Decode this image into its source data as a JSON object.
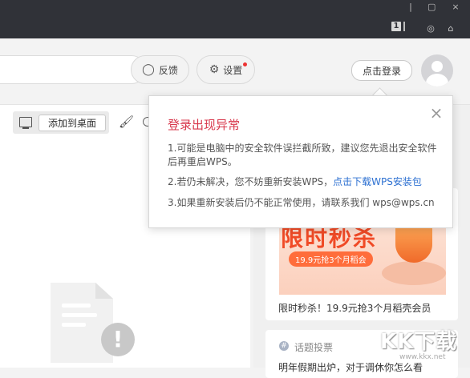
{
  "titlebar": {
    "tab_count": "1"
  },
  "header": {
    "feedback_label": "反馈",
    "settings_label": "设置",
    "login_label": "点击登录"
  },
  "toolbar": {
    "add_to_desktop_label": "添加到桌面"
  },
  "popup": {
    "title": "登录出现异常",
    "close_icon": "×",
    "line1": "1.可能是电脑中的安全软件误拦截所致，建议您先退出安全软件后再重启WPS。",
    "line2_prefix": "2.若仍未解决，您不妨重新安装WPS，",
    "line2_link": "点击下载WPS安装包",
    "line3": "3.如果重新安装后仍不能正常使用，请联系我们 wps@wps.cn"
  },
  "promo_card": {
    "banner_big_text": "限时秒杀",
    "banner_pill": "19.9元抢3个月稻会",
    "caption": "限时秒杀！19.9元抢3个月稻壳会员"
  },
  "topic_card": {
    "label": "话题投票",
    "cut_text": "明年假期出炉，对于调休你怎么看"
  },
  "watermark": {
    "text": "KK下载",
    "sub": "www.kkx.net"
  },
  "colors": {
    "titlebar": "#303238",
    "accent_red": "#d8384c",
    "link_blue": "#2b6fd1"
  },
  "icons": [
    "tab-count-icon",
    "skin-icon",
    "shirt-icon",
    "chat-bubble-icon",
    "gear-icon",
    "avatar-icon",
    "monitor-icon",
    "brush-icon",
    "clock-icon",
    "document-icon",
    "warning-icon",
    "close-icon",
    "topic-icon"
  ]
}
